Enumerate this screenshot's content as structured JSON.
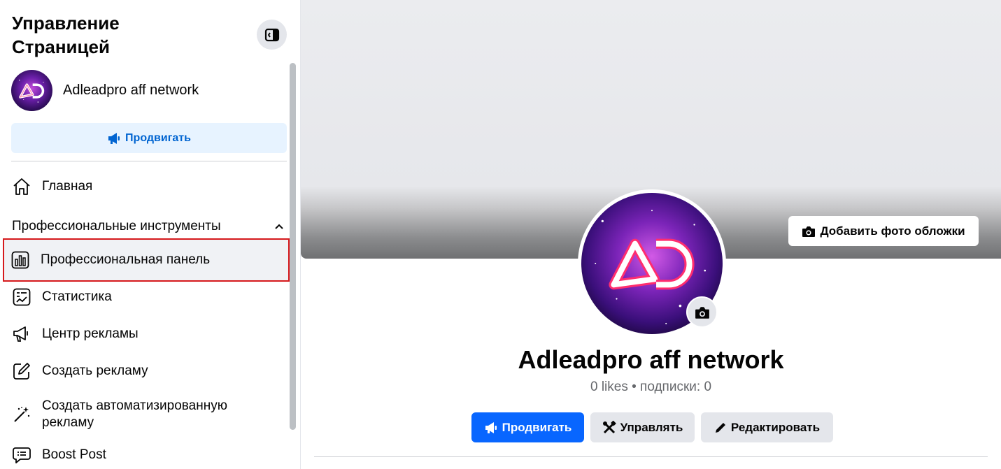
{
  "sidebar": {
    "title": "Управление Страницей",
    "page_name": "Adleadpro aff network",
    "promote_label": "Продвигать",
    "home_label": "Главная",
    "section_label": "Профессиональные инструменты",
    "items": [
      {
        "label": "Профессиональная панель",
        "icon": "dashboard-icon"
      },
      {
        "label": "Статистика",
        "icon": "insights-icon"
      },
      {
        "label": "Центр рекламы",
        "icon": "megaphone-icon"
      },
      {
        "label": "Создать рекламу",
        "icon": "pencil-square-icon"
      },
      {
        "label": "Создать автоматизированную рекламу",
        "icon": "magic-wand-icon"
      },
      {
        "label": "Boost Post",
        "icon": "chat-bubble-icon"
      }
    ]
  },
  "main": {
    "add_cover_label": "Добавить фото обложки",
    "profile_name": "Adleadpro aff network",
    "stats": "0 likes • подписки: 0",
    "buttons": {
      "promote": "Продвигать",
      "manage": "Управлять",
      "edit": "Редактировать"
    }
  },
  "colors": {
    "accent": "#0866ff",
    "promote_bg": "#e7f3ff",
    "promote_text": "#0064d1",
    "highlight": "#d6191c",
    "secondary_btn": "#e4e6eb"
  }
}
